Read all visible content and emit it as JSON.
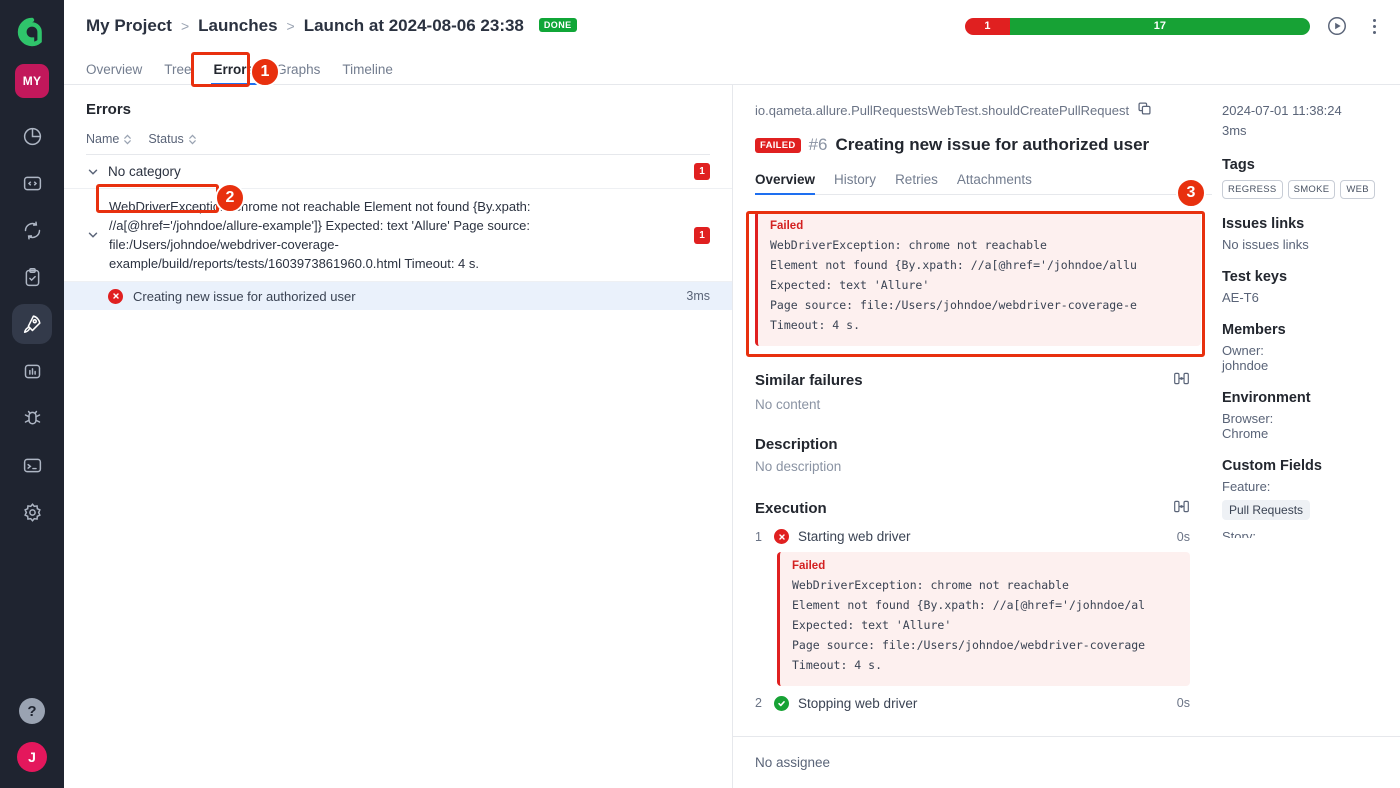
{
  "rail": {
    "logo": "allure-logo",
    "workspace": "MY",
    "icons": [
      {
        "name": "pie-chart-icon",
        "active": false
      },
      {
        "name": "code-icon",
        "active": false
      },
      {
        "name": "sync-icon",
        "active": false
      },
      {
        "name": "clipboard-check-icon",
        "active": false
      },
      {
        "name": "rocket-icon",
        "active": true
      },
      {
        "name": "bar-chart-icon",
        "active": false
      },
      {
        "name": "bug-icon",
        "active": false
      },
      {
        "name": "terminal-icon",
        "active": false
      },
      {
        "name": "gear-icon",
        "active": false
      }
    ],
    "help": "?",
    "avatar": "J"
  },
  "header": {
    "breadcrumb": [
      "My Project",
      "Launches",
      "Launch at 2024-08-06 23:38"
    ],
    "separator": ">",
    "status_badge": "DONE",
    "progress": {
      "failed": "1",
      "passed": "17",
      "failed_pct": 13,
      "passed_pct": 87
    },
    "run_button": "run-icon",
    "more_button": "kebab-icon"
  },
  "tabs": [
    {
      "label": "Overview",
      "active": false
    },
    {
      "label": "Tree",
      "active": false
    },
    {
      "label": "Errors",
      "active": true
    },
    {
      "label": "Graphs",
      "active": false
    },
    {
      "label": "Timeline",
      "active": false
    }
  ],
  "errors_panel": {
    "title": "Errors",
    "sort": [
      {
        "label": "Name"
      },
      {
        "label": "Status"
      }
    ],
    "category": {
      "label": "No category",
      "count": "1"
    },
    "error_group": {
      "text": "WebDriverException: chrome not reachable Element not found {By.xpath: //a[@href='/johndoe/allure-example']} Expected: text 'Allure' Page source: file:/Users/johndoe/webdriver-coverage-example/build/reports/tests/1603973861960.0.html Timeout: 4 s.",
      "count": "1"
    },
    "test": {
      "name": "Creating new issue for authorized user",
      "duration": "3ms",
      "status": "failed"
    }
  },
  "detail": {
    "fqn": "io.qameta.allure.PullRequestsWebTest.shouldCreatePullRequest",
    "copy_icon": "copy-icon",
    "status_badge": "FAILED",
    "number": "#6",
    "title": "Creating new issue for authorized user",
    "subtabs": [
      {
        "label": "Overview",
        "active": true
      },
      {
        "label": "History",
        "active": false
      },
      {
        "label": "Retries",
        "active": false
      },
      {
        "label": "Attachments",
        "active": false
      }
    ],
    "failure": {
      "label": "Failed",
      "body": "WebDriverException: chrome not reachable\nElement not found {By.xpath: //a[@href='/johndoe/allu\nExpected: text 'Allure'\nPage source: file:/Users/johndoe/webdriver-coverage-e\nTimeout: 4 s."
    },
    "similar_failures": {
      "title": "Similar failures",
      "value": "No content",
      "icon": "expand-collapse-icon"
    },
    "description": {
      "title": "Description",
      "value": "No description"
    },
    "execution": {
      "title": "Execution",
      "icon": "expand-collapse-icon",
      "steps": [
        {
          "index": "1",
          "name": "Starting web driver",
          "duration": "0s",
          "status": "failed",
          "failure": {
            "label": "Failed",
            "body": "WebDriverException: chrome not reachable\nElement not found {By.xpath: //a[@href='/johndoe/al\nExpected: text 'Allure'\nPage source: file:/Users/johndoe/webdriver-coverage\nTimeout: 4 s."
          }
        },
        {
          "index": "2",
          "name": "Stopping web driver",
          "duration": "0s",
          "status": "passed"
        }
      ]
    },
    "assignee": "No assignee"
  },
  "aside": {
    "timestamp": "2024-07-01 11:38:24",
    "duration": "3ms",
    "tags_title": "Tags",
    "tags": [
      "REGRESS",
      "SMOKE",
      "WEB"
    ],
    "issues_title": "Issues links",
    "issues_value": "No issues links",
    "testkeys_title": "Test keys",
    "testkeys_value": "AE-T6",
    "members_title": "Members",
    "members_label": "Owner:",
    "members_value": "johndoe",
    "environment_title": "Environment",
    "environment_label": "Browser:",
    "environment_value": "Chrome",
    "customfields_title": "Custom Fields",
    "customfields_label": "Feature:",
    "customfields_value": "Pull Requests",
    "customfields_next": "Story:"
  },
  "annotations": [
    {
      "number": "1",
      "target": "errors-tab"
    },
    {
      "number": "2",
      "target": "no-category-row"
    },
    {
      "number": "3",
      "target": "failure-message-box"
    }
  ],
  "colors": {
    "accent_blue": "#1e6ff0",
    "fail_red": "#e02020",
    "pass_green": "#17a235",
    "annotation_red": "#e8300e",
    "rail_bg": "#1f2430",
    "workspace_pink": "#c2185b"
  }
}
